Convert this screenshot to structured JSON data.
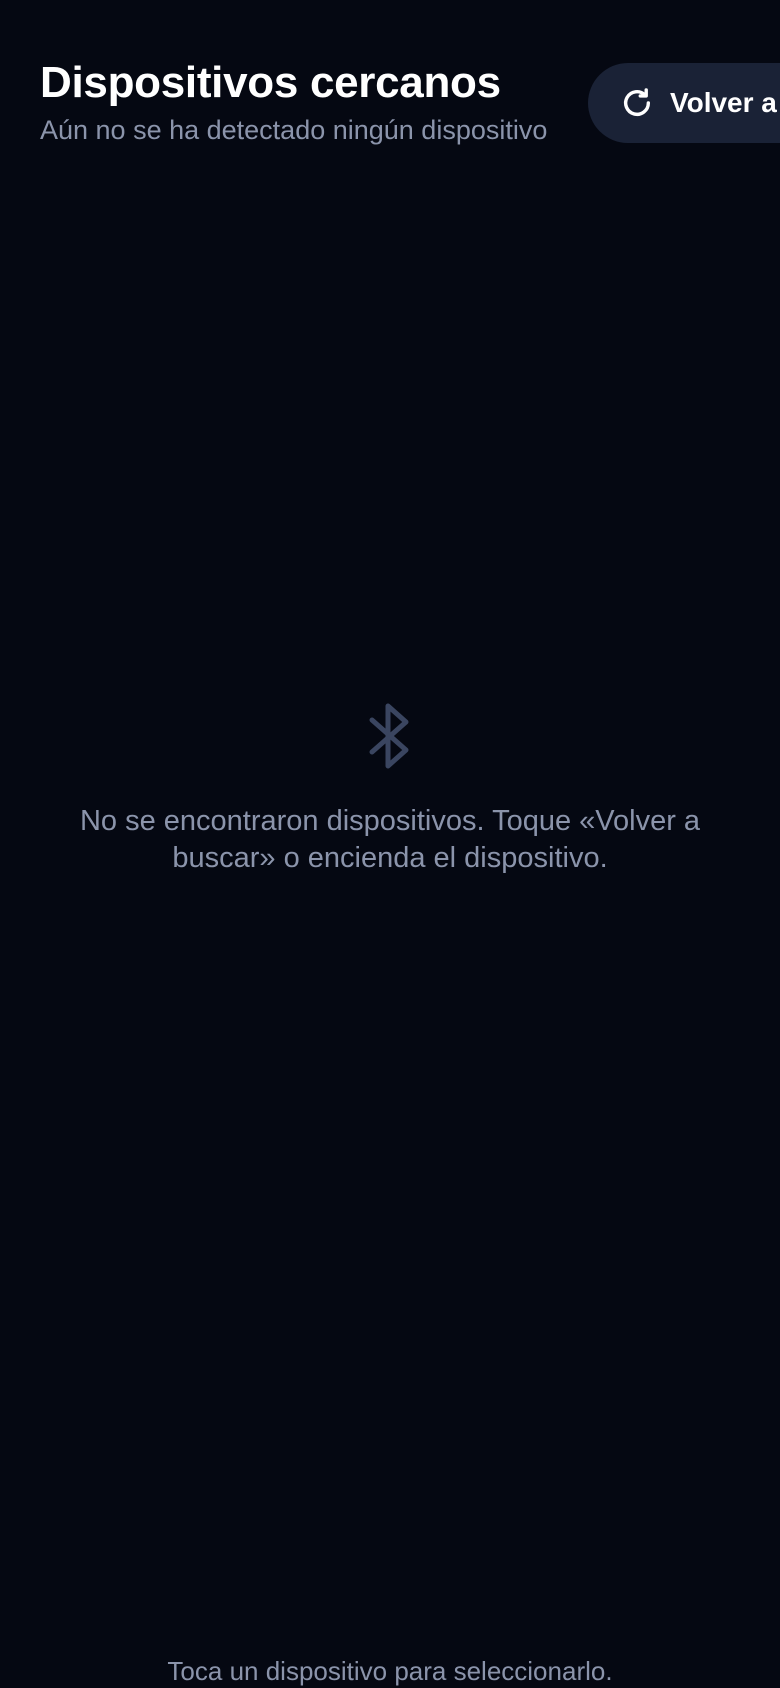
{
  "header": {
    "title": "Dispositivos cercanos",
    "subtitle": "Aún no se ha detectado ningún dispositivo"
  },
  "rescan_button": {
    "label": "Volver a buscar",
    "icon": "refresh-icon"
  },
  "empty_state": {
    "icon": "bluetooth-icon",
    "message": "No se encontraron dispositivos. Toque «Volver a buscar» o encienda el dispositivo."
  },
  "footer": {
    "hint": "Toca un dispositivo para seleccionarlo."
  },
  "colors": {
    "background": "#050812",
    "button_background": "#1a2236",
    "muted_text": "#8b94ab",
    "icon_muted": "#3a4560",
    "title_text": "#ffffff"
  }
}
